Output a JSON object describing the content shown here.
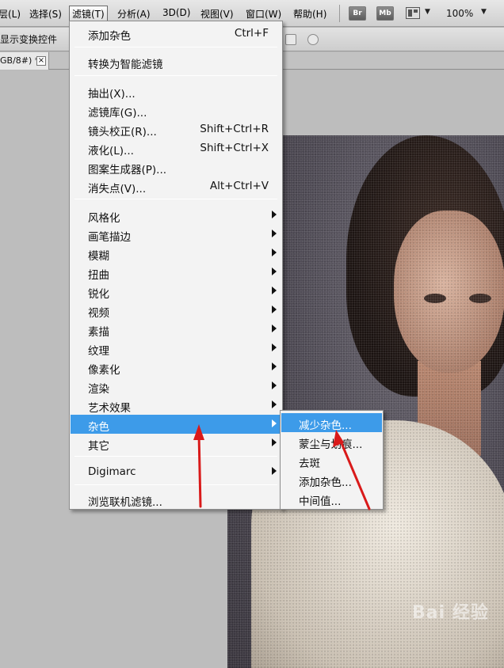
{
  "menubar": {
    "items": [
      "层(L)",
      "选择(S)",
      "滤镜(T)",
      "分析(A)",
      "3D(D)",
      "视图(V)",
      "窗口(W)",
      "帮助(H)"
    ],
    "badges": [
      "Br",
      "Mb"
    ],
    "zoom": "100%"
  },
  "options_bar": {
    "label": "显示变换控件"
  },
  "document_tab": {
    "title": "GB/8#) *",
    "close": "×"
  },
  "filter_menu": {
    "items": [
      {
        "label": "添加杂色",
        "shortcut": "Ctrl+F"
      },
      {
        "label": "转换为智能滤镜",
        "shortcut": ""
      },
      {
        "label": "抽出(X)...",
        "shortcut": ""
      },
      {
        "label": "滤镜库(G)...",
        "shortcut": ""
      },
      {
        "label": "镜头校正(R)...",
        "shortcut": "Shift+Ctrl+R"
      },
      {
        "label": "液化(L)...",
        "shortcut": "Shift+Ctrl+X"
      },
      {
        "label": "图案生成器(P)...",
        "shortcut": ""
      },
      {
        "label": "消失点(V)...",
        "shortcut": "Alt+Ctrl+V"
      },
      {
        "label": "风格化",
        "shortcut": ""
      },
      {
        "label": "画笔描边",
        "shortcut": ""
      },
      {
        "label": "模糊",
        "shortcut": ""
      },
      {
        "label": "扭曲",
        "shortcut": ""
      },
      {
        "label": "锐化",
        "shortcut": ""
      },
      {
        "label": "视频",
        "shortcut": ""
      },
      {
        "label": "素描",
        "shortcut": ""
      },
      {
        "label": "纹理",
        "shortcut": ""
      },
      {
        "label": "像素化",
        "shortcut": ""
      },
      {
        "label": "渲染",
        "shortcut": ""
      },
      {
        "label": "艺术效果",
        "shortcut": ""
      },
      {
        "label": "杂色",
        "shortcut": ""
      },
      {
        "label": "其它",
        "shortcut": ""
      },
      {
        "label": "Digimarc",
        "shortcut": ""
      },
      {
        "label": "浏览联机滤镜...",
        "shortcut": ""
      }
    ]
  },
  "noise_submenu": {
    "items": [
      {
        "label": "减少杂色..."
      },
      {
        "label": "蒙尘与划痕..."
      },
      {
        "label": "去斑"
      },
      {
        "label": "添加杂色..."
      },
      {
        "label": "中间值..."
      }
    ]
  },
  "watermark": "Bai 经验",
  "colors": {
    "highlight": "#3d9be9",
    "annotation": "#d91a1a",
    "menu_bg": "#f3f3f3"
  }
}
